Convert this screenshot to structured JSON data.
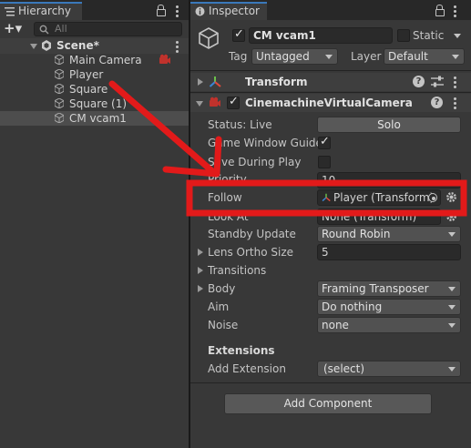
{
  "hierarchy": {
    "tab_label": "Hierarchy",
    "add_label": "+▾",
    "search_placeholder": "All",
    "scene_name": "Scene*",
    "items": [
      {
        "label": "Main Camera"
      },
      {
        "label": "Player"
      },
      {
        "label": "Square"
      },
      {
        "label": "Square (1)"
      },
      {
        "label": "CM vcam1"
      }
    ]
  },
  "inspector": {
    "tab_label": "Inspector",
    "object_name": "CM vcam1",
    "static_label": "Static",
    "tag_label": "Tag",
    "tag_value": "Untagged",
    "layer_label": "Layer",
    "layer_value": "Default",
    "transform_title": "Transform",
    "vcam_title": "CinemachineVirtualCamera",
    "status_label": "Status: Live",
    "solo_label": "Solo",
    "game_window_guides_label": "Game Window Guides",
    "save_during_play_label": "Save During Play",
    "priority_label": "Priority",
    "priority_value": "10",
    "follow_label": "Follow",
    "follow_value": "Player (Transform)",
    "look_at_label": "Look At",
    "look_at_value": "None (Transform)",
    "standby_label": "Standby Update",
    "standby_value": "Round Robin",
    "ortho_label": "Lens Ortho Size",
    "ortho_value": "5",
    "transitions_label": "Transitions",
    "body_label": "Body",
    "body_value": "Framing Transposer",
    "aim_label": "Aim",
    "aim_value": "Do nothing",
    "noise_label": "Noise",
    "noise_value": "none",
    "extensions_label": "Extensions",
    "add_extension_label": "Add Extension",
    "add_extension_value": "(select)",
    "add_component_label": "Add Component"
  },
  "colors": {
    "highlight_box": "#e21a1a",
    "tab_accent": "#3a79bb",
    "arrow": "#e21a1a"
  }
}
